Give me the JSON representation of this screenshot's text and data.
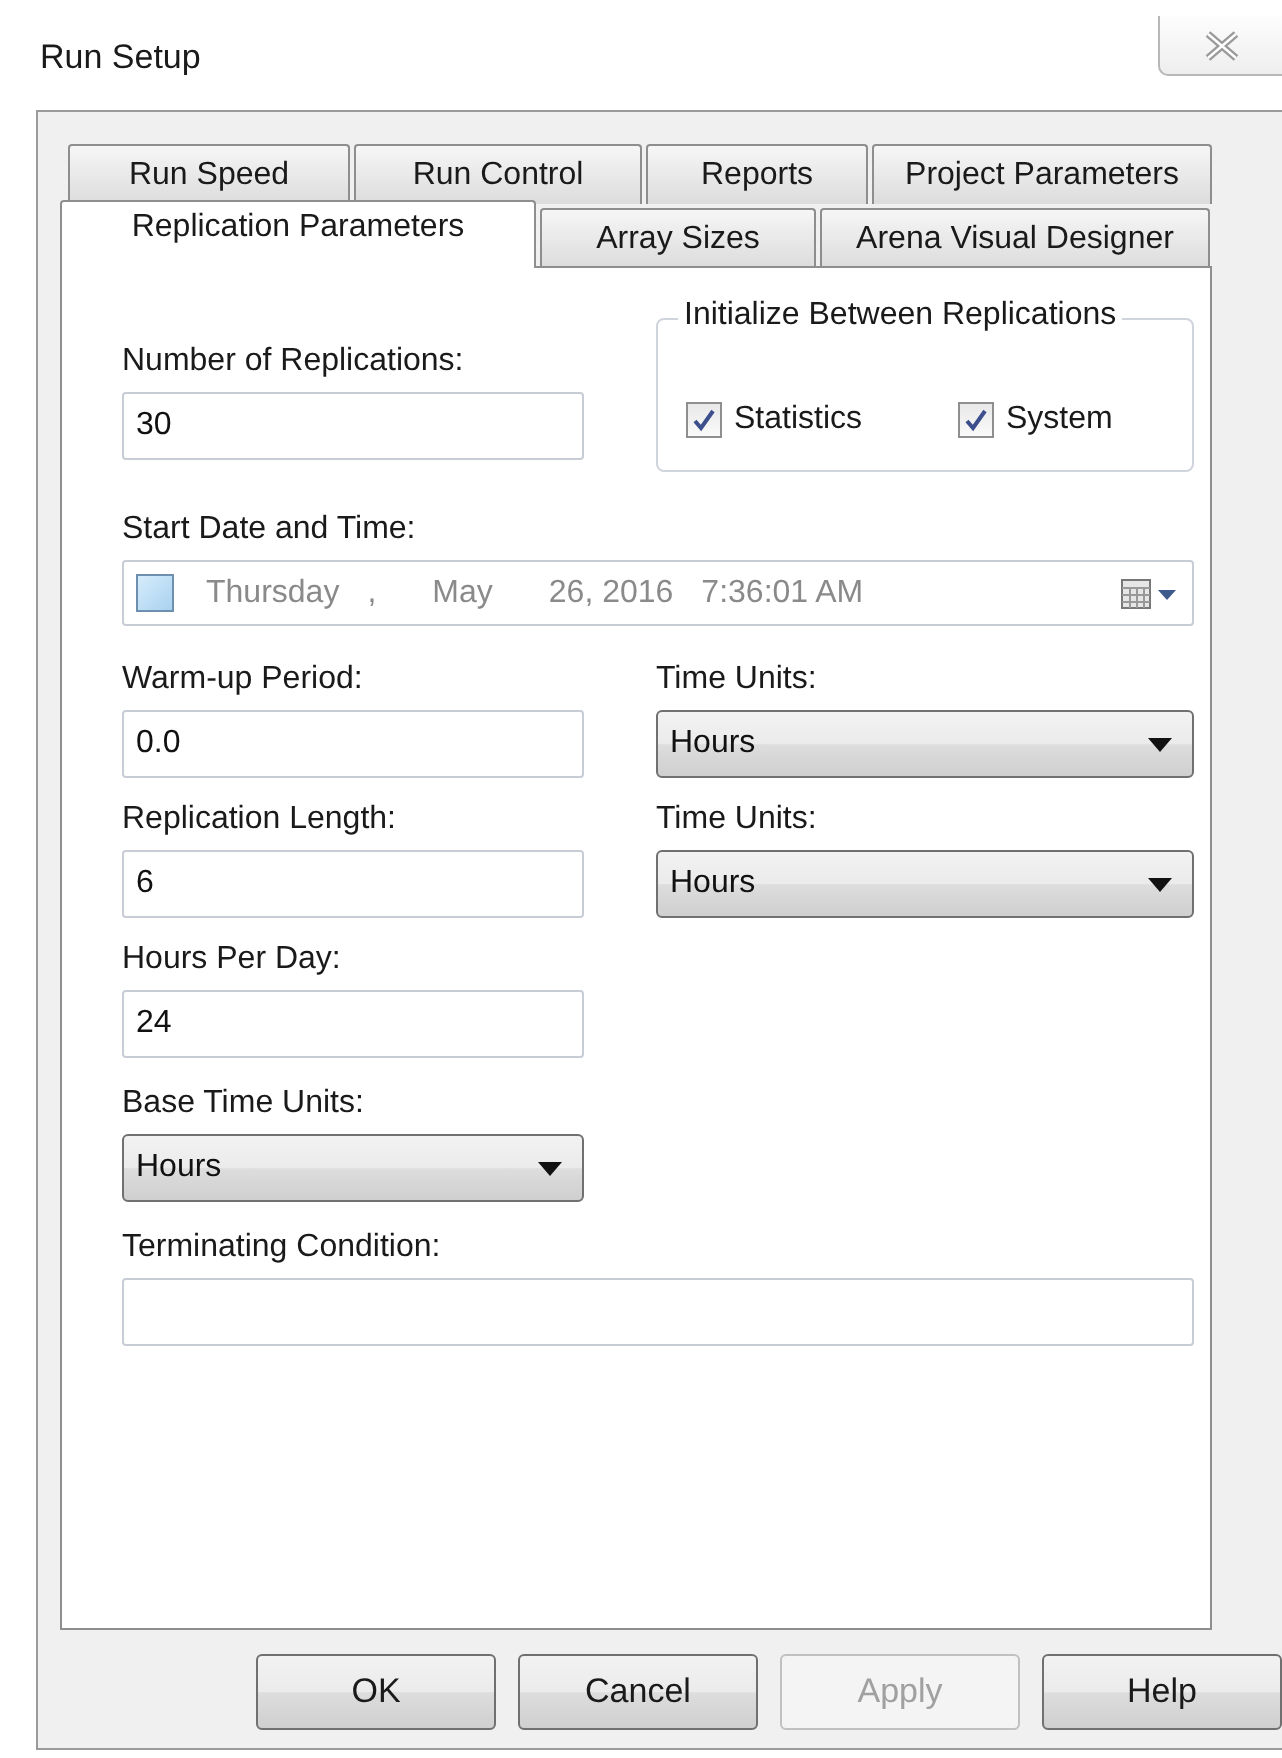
{
  "window": {
    "title": "Run Setup"
  },
  "tabs": {
    "back_row": [
      {
        "label": "Run Speed",
        "selected": false
      },
      {
        "label": "Run Control",
        "selected": false
      },
      {
        "label": "Reports",
        "selected": false
      },
      {
        "label": "Project Parameters",
        "selected": false
      }
    ],
    "front_row": [
      {
        "label": "Replication Parameters",
        "selected": true
      },
      {
        "label": "Array Sizes",
        "selected": false
      },
      {
        "label": "Arena Visual Designer",
        "selected": false
      }
    ]
  },
  "replication_parameters": {
    "number_of_replications": {
      "label": "Number of Replications:",
      "value": "30"
    },
    "initialize_between_replications": {
      "title": "Initialize Between Replications",
      "checkboxes": [
        {
          "label": "Statistics",
          "checked": true
        },
        {
          "label": "System",
          "checked": true
        }
      ]
    },
    "start_date_and_time": {
      "label": "Start Date and Time:",
      "checked": false,
      "weekday": "Thursday",
      "separator": ",",
      "month": "May",
      "date": "26, 2016",
      "time": "7:36:01 AM"
    },
    "warm_up_period": {
      "label": "Warm-up Period:",
      "value": "0.0"
    },
    "warm_up_time_units": {
      "label": "Time Units:",
      "value": "Hours"
    },
    "replication_length": {
      "label": "Replication Length:",
      "value": "6"
    },
    "length_time_units": {
      "label": "Time Units:",
      "value": "Hours"
    },
    "hours_per_day": {
      "label": "Hours Per Day:",
      "value": "24"
    },
    "base_time_units": {
      "label": "Base Time Units:",
      "value": "Hours"
    },
    "terminating_condition": {
      "label": "Terminating Condition:"
    }
  },
  "buttons": [
    {
      "label": "OK",
      "disabled": false
    },
    {
      "label": "Cancel",
      "disabled": false
    },
    {
      "label": "Apply",
      "disabled": true
    },
    {
      "label": "Help",
      "disabled": false
    }
  ]
}
